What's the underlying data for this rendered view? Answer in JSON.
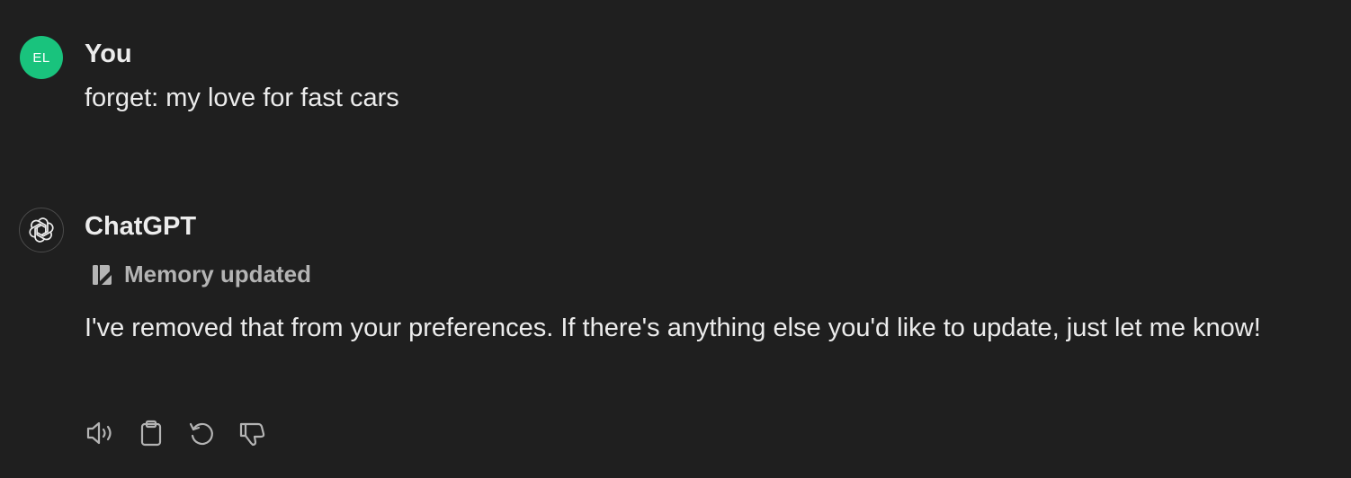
{
  "user_message": {
    "avatar_initials": "EL",
    "avatar_color": "#19c37d",
    "author": "You",
    "text": "forget: my love for fast cars"
  },
  "assistant_message": {
    "avatar_icon": "openai-logo-icon",
    "author": "ChatGPT",
    "memory_status": {
      "icon": "memory-icon",
      "label": "Memory updated"
    },
    "text": "I've removed that from your preferences. If there's anything else you'd like to update, just let me know!",
    "actions": [
      {
        "name": "read-aloud",
        "icon": "speaker-icon"
      },
      {
        "name": "copy",
        "icon": "clipboard-icon"
      },
      {
        "name": "regenerate",
        "icon": "refresh-icon"
      },
      {
        "name": "bad-response",
        "icon": "thumbs-down-icon"
      }
    ]
  },
  "colors": {
    "background": "#1f1f1f",
    "text": "#ececec",
    "muted": "#b4b4b4"
  }
}
